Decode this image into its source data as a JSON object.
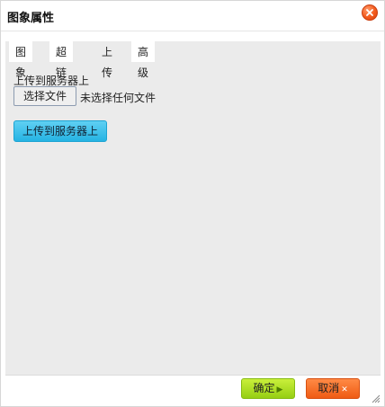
{
  "dialog": {
    "title": "图象属性",
    "close_icon": "close-icon"
  },
  "tabs": [
    {
      "label": "图象",
      "active": false
    },
    {
      "label": "超链接",
      "active": false
    },
    {
      "label": "上传",
      "active": true
    },
    {
      "label": "高级",
      "active": false
    }
  ],
  "upload": {
    "section_label": "上传到服务器上",
    "file_button_label": "选择文件",
    "file_status": "未选择任何文件",
    "upload_button_label": "上传到服务器上"
  },
  "footer": {
    "ok_label": "确定",
    "ok_icon": "▶",
    "cancel_label": "取消",
    "cancel_icon": "✕"
  },
  "colors": {
    "close_accent": "#f35a1c",
    "upload_button": "#25b3e3",
    "ok_button": "#96cf14",
    "cancel_button": "#ef5b14",
    "body_background": "#ebebeb"
  }
}
